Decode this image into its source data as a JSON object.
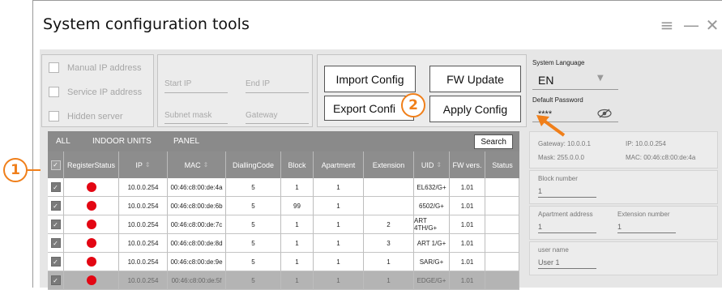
{
  "window": {
    "title": "System configuration tools"
  },
  "ip_options": {
    "manual": "Manual IP address",
    "service": "Service IP address",
    "hidden": "Hidden server"
  },
  "ip_fields": {
    "start_ip": "Start IP",
    "end_ip": "End IP",
    "subnet_mask": "Subnet mask",
    "gateway": "Gateway"
  },
  "buttons": {
    "import": "Import Config",
    "fw_update": "FW Update",
    "export": "Export Confi",
    "apply": "Apply Config"
  },
  "system": {
    "language_label": "System Language",
    "language_value": "EN",
    "password_label": "Default Password",
    "password_value": "****"
  },
  "tabs": {
    "all": "ALL",
    "indoor": "INDOOR UNITS",
    "panel": "PANEL",
    "search": "Search"
  },
  "table": {
    "headers": [
      "RegisterStatus",
      "IP",
      "MAC",
      "DiallingCode",
      "Block",
      "Apartment",
      "Extension",
      "UID",
      "FW vers.",
      "Status"
    ],
    "rows": [
      {
        "ip": "10.0.0.254",
        "mac": "00:46:c8:00:de:4a",
        "code": "5",
        "block": "1",
        "apt": "1",
        "ext": "",
        "uid": "EL632/G+",
        "fw": "1.01",
        "status": ""
      },
      {
        "ip": "10.0.0.254",
        "mac": "00:46:c8:00:de:6b",
        "code": "5",
        "block": "99",
        "apt": "1",
        "ext": "",
        "uid": "6502/G+",
        "fw": "1.01",
        "status": ""
      },
      {
        "ip": "10.0.0.254",
        "mac": "00:46:c8:00:de:7c",
        "code": "5",
        "block": "1",
        "apt": "1",
        "ext": "2",
        "uid": "ART 4TH/G+",
        "fw": "1.01",
        "status": ""
      },
      {
        "ip": "10.0.0.254",
        "mac": "00:46:c8:00:de:8d",
        "code": "5",
        "block": "1",
        "apt": "1",
        "ext": "3",
        "uid": "ART 1/G+",
        "fw": "1.01",
        "status": ""
      },
      {
        "ip": "10.0.0.254",
        "mac": "00:46:c8:00:de:9e",
        "code": "5",
        "block": "1",
        "apt": "1",
        "ext": "1",
        "uid": "SAR/G+",
        "fw": "1.01",
        "status": ""
      },
      {
        "ip": "10.0.0.254",
        "mac": "00:46:c8:00:de:5f",
        "code": "5",
        "block": "1",
        "apt": "1",
        "ext": "1",
        "uid": "EDGE/G+",
        "fw": "1.01",
        "status": ""
      }
    ]
  },
  "device_info": {
    "gateway": "Gateway:  10.0.0.1",
    "ip": "IP:  10.0.0.254",
    "mask": "Mask: 255.0.0.0",
    "mac": "MAC:  00:46:c8:00:de:4a",
    "block_label": "Block number",
    "block_value": "1",
    "apartment_label": "Apartment address",
    "apartment_value": "1",
    "extension_label": "Extension number",
    "extension_value": "1",
    "username_label": "user name",
    "username_value": "User 1"
  },
  "callouts": {
    "one": "1",
    "two": "2"
  },
  "colors": {
    "accent": "#f07f1a",
    "status_dot": "#e30613",
    "header_bg": "#8d8d8d"
  }
}
